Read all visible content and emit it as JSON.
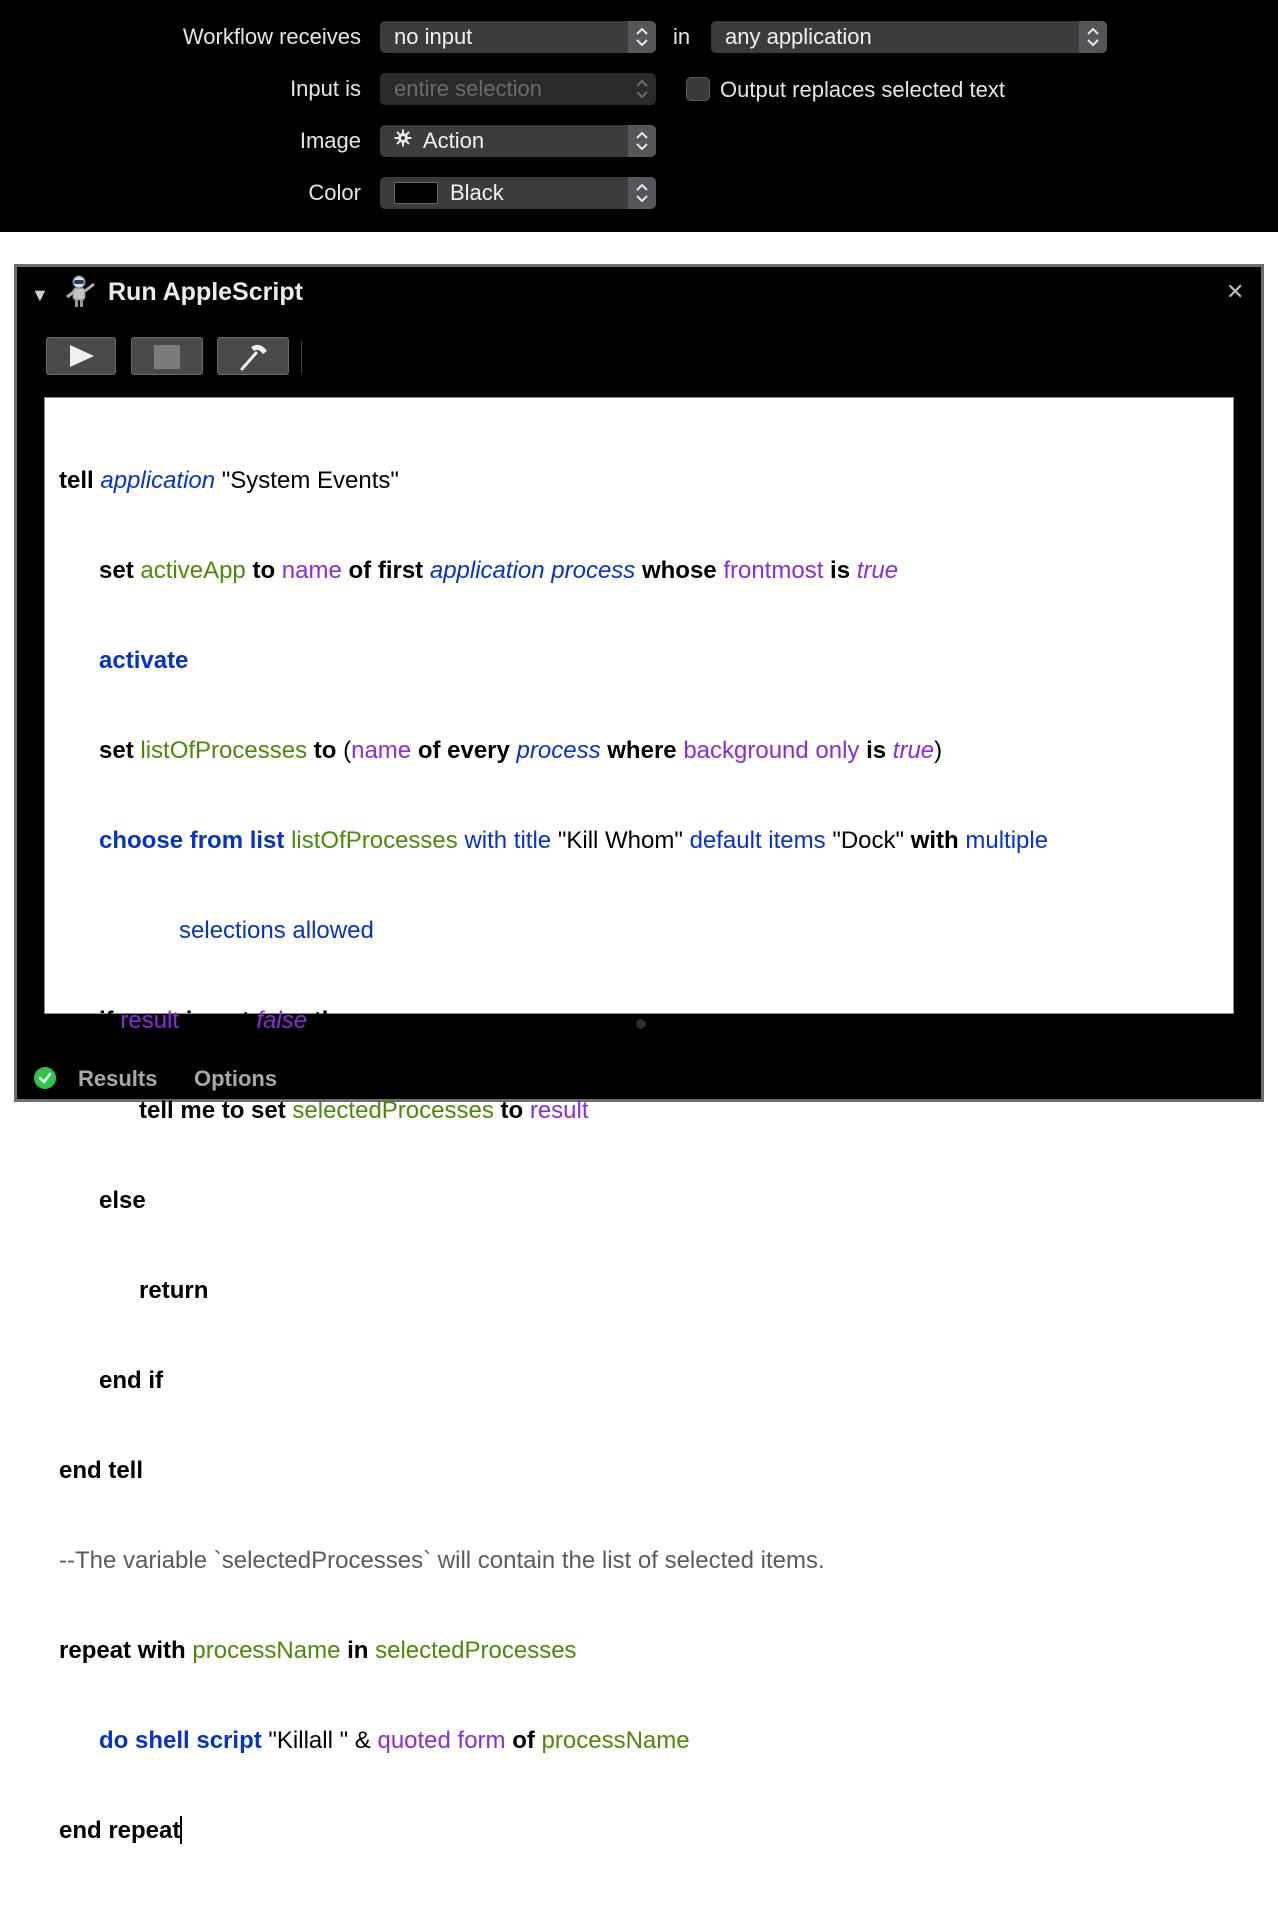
{
  "settings": {
    "workflow_receives_label": "Workflow receives",
    "workflow_receives_value": "no input",
    "in_label": "in",
    "application_value": "any application",
    "input_is_label": "Input is",
    "input_is_value": "entire selection",
    "output_replaces_label": "Output replaces selected text",
    "output_replaces_checked": false,
    "image_label": "Image",
    "image_value": "Action",
    "image_icon": "gear-icon",
    "color_label": "Color",
    "color_value": "Black",
    "color_swatch": "#000000"
  },
  "action": {
    "title": "Run AppleScript",
    "icon": "automator-robot-icon",
    "toolbar": [
      "run-icon",
      "stop-icon",
      "compile-hammer-icon"
    ],
    "script_lines": [
      "tell application \"System Events\"",
      "set activeApp to name of first application process whose frontmost is true",
      "activate",
      "set listOfProcesses to (name of every process where background only is true)",
      "choose from list listOfProcesses with title \"Kill Whom\" default items \"Dock\" with multiple",
      "selections allowed",
      "if result is not false then",
      "tell me to set selectedProcesses to result",
      "else",
      "return",
      "end if",
      "end tell",
      "--The variable `selectedProcesses` will contain the list of selected items.",
      "repeat with processName in selectedProcesses",
      "do shell script \"Killall \" & quoted form of processName",
      "end repeat"
    ],
    "footer": {
      "status": "success",
      "results_label": "Results",
      "options_label": "Options"
    }
  }
}
